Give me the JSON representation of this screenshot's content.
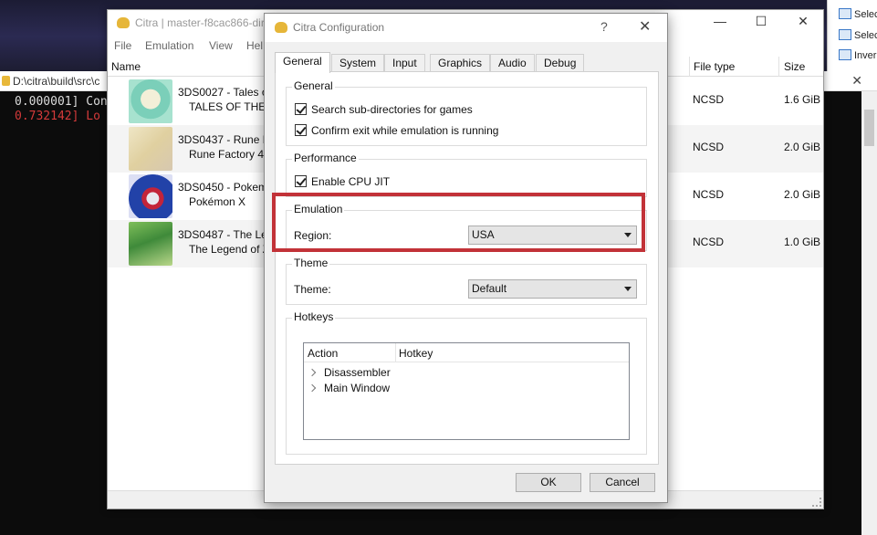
{
  "console": {
    "path": "D:\\citra\\build\\src\\c",
    "close": "✕",
    "line1": "0.000001] Con",
    "line2": "0.732142] Lo"
  },
  "ribbon": {
    "items": [
      "Selec",
      "Selec",
      "Inver"
    ]
  },
  "citra_window": {
    "title": "Citra | master-f8cac866-dirt",
    "minimize": "—",
    "maximize": "☐",
    "close": "✕",
    "menu": [
      "File",
      "Emulation",
      "View",
      "Hel"
    ],
    "columns": {
      "name": "Name",
      "file_type": "File type",
      "size": "Size"
    },
    "games": [
      {
        "id": "3DS0027 - Tales of",
        "name": "TALES OF THE A",
        "type": "NCSD",
        "size": "1.6 GiB"
      },
      {
        "id": "3DS0437 - Rune Fa",
        "name": "Rune Factory 4",
        "type": "NCSD",
        "size": "2.0 GiB"
      },
      {
        "id": "3DS0450 - Pokemo",
        "name": "Pokémon X",
        "type": "NCSD",
        "size": "2.0 GiB"
      },
      {
        "id": "3DS0487 - The Leg",
        "name": "The Legend of Z",
        "type": "NCSD",
        "size": "1.0 GiB"
      }
    ]
  },
  "dialog": {
    "title": "Citra Configuration",
    "help": "?",
    "close": "✕",
    "tabs": [
      "General",
      "System",
      "Input",
      "Graphics",
      "Audio",
      "Debug"
    ],
    "general_group": {
      "title": "General",
      "search_subdirs": "Search sub-directories for games",
      "confirm_exit": "Confirm exit while emulation is running"
    },
    "performance_group": {
      "title": "Performance",
      "cpu_jit": "Enable CPU JIT"
    },
    "emulation_group": {
      "title": "Emulation",
      "region_label": "Region:",
      "region_value": "USA"
    },
    "theme_group": {
      "title": "Theme",
      "theme_label": "Theme:",
      "theme_value": "Default"
    },
    "hotkeys_group": {
      "title": "Hotkeys",
      "col_action": "Action",
      "col_hotkey": "Hotkey",
      "items": [
        "Disassembler",
        "Main Window"
      ]
    },
    "ok": "OK",
    "cancel": "Cancel"
  },
  "colors": {
    "highlight": "#c23238",
    "console_error": "#d43a3a"
  }
}
